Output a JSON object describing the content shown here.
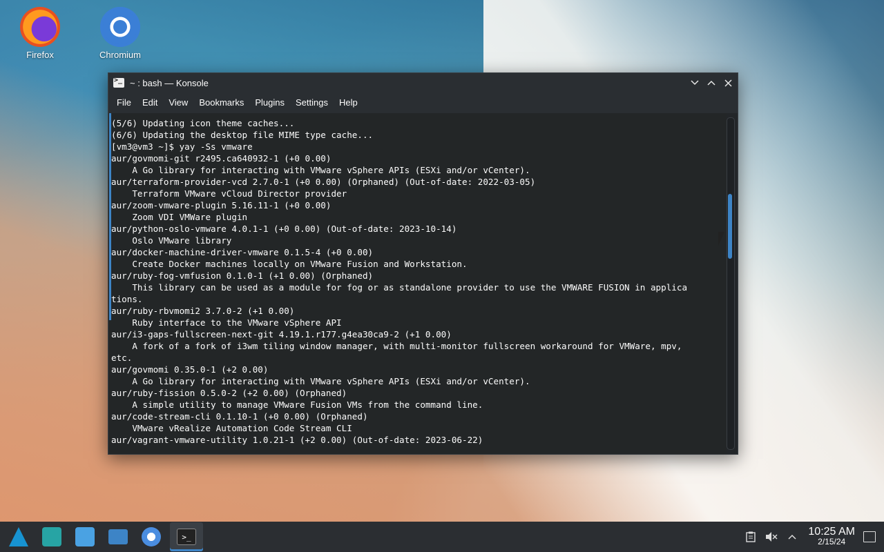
{
  "desktop": {
    "icons": [
      {
        "label": "Firefox",
        "icon": "firefox-icon"
      },
      {
        "label": "Chromium",
        "icon": "chromium-icon"
      }
    ]
  },
  "window": {
    "title": "~ : bash — Konsole",
    "menu": [
      "File",
      "Edit",
      "View",
      "Bookmarks",
      "Plugins",
      "Settings",
      "Help"
    ],
    "terminal_lines": [
      "(5/6) Updating icon theme caches...",
      "(6/6) Updating the desktop file MIME type cache...",
      "[vm3@vm3 ~]$ yay -Ss vmware",
      "aur/govmomi-git r2495.ca640932-1 (+0 0.00)",
      "    A Go library for interacting with VMware vSphere APIs (ESXi and/or vCenter).",
      "aur/terraform-provider-vcd 2.7.0-1 (+0 0.00) (Orphaned) (Out-of-date: 2022-03-05)",
      "    Terraform VMware vCloud Director provider",
      "aur/zoom-vmware-plugin 5.16.11-1 (+0 0.00)",
      "    Zoom VDI VMWare plugin",
      "aur/python-oslo-vmware 4.0.1-1 (+0 0.00) (Out-of-date: 2023-10-14)",
      "    Oslo VMware library",
      "aur/docker-machine-driver-vmware 0.1.5-4 (+0 0.00)",
      "    Create Docker machines locally on VMware Fusion and Workstation.",
      "aur/ruby-fog-vmfusion 0.1.0-1 (+1 0.00) (Orphaned)",
      "    This library can be used as a module for fog or as standalone provider to use the VMWARE FUSION in applica",
      "tions.",
      "aur/ruby-rbvmomi2 3.7.0-2 (+1 0.00)",
      "    Ruby interface to the VMware vSphere API",
      "aur/i3-gaps-fullscreen-next-git 4.19.1.r177.g4ea30ca9-2 (+1 0.00)",
      "    A fork of a fork of i3wm tiling window manager, with multi-monitor fullscreen workaround for VMWare, mpv,",
      "etc.",
      "aur/govmomi 0.35.0-1 (+2 0.00)",
      "    A Go library for interacting with VMware vSphere APIs (ESXi and/or vCenter).",
      "aur/ruby-fission 0.5.0-2 (+2 0.00) (Orphaned)",
      "    A simple utility to manage VMware Fusion VMs from the command line.",
      "aur/code-stream-cli 0.1.10-1 (+0 0.00) (Orphaned)",
      "    VMware vRealize Automation Code Stream CLI",
      "aur/vagrant-vmware-utility 1.0.21-1 (+2 0.00) (Out-of-date: 2023-06-22)"
    ]
  },
  "taskbar": {
    "apps": [
      "app-launcher-icon",
      "discover-wrench-icon",
      "store-icon",
      "file-manager-icon",
      "chromium-icon",
      "konsole-icon"
    ],
    "tray": [
      "clipboard-icon",
      "volume-muted-icon",
      "chevron-up-icon"
    ],
    "time": "10:25 AM",
    "date": "2/15/24"
  }
}
